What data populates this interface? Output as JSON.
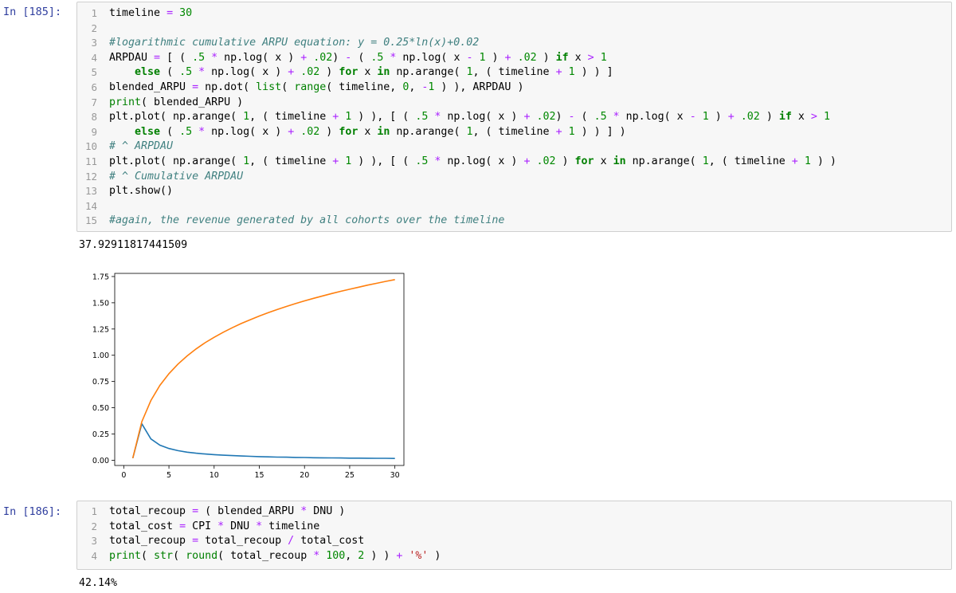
{
  "cells": [
    {
      "prompt": "In [185]:",
      "lines": [
        [
          [
            "timeline ",
            ""
          ],
          [
            "=",
            "o"
          ],
          [
            " ",
            ""
          ],
          [
            "30",
            "n"
          ]
        ],
        [],
        [
          [
            "#logarithmic cumulative ARPU equation: y = 0.25*ln(x)+0.02",
            "c"
          ]
        ],
        [
          [
            "ARPDAU ",
            ""
          ],
          [
            "=",
            "o"
          ],
          [
            " [ ( ",
            ""
          ],
          [
            ".5",
            "n"
          ],
          [
            " ",
            ""
          ],
          [
            "*",
            "o"
          ],
          [
            " np.log( x ) ",
            ""
          ],
          [
            "+",
            "o"
          ],
          [
            " ",
            ""
          ],
          [
            ".02",
            "n"
          ],
          [
            ") ",
            ""
          ],
          [
            "-",
            "o"
          ],
          [
            " ( ",
            ""
          ],
          [
            ".5",
            "n"
          ],
          [
            " ",
            ""
          ],
          [
            "*",
            "o"
          ],
          [
            " np.log( x ",
            ""
          ],
          [
            "-",
            "o"
          ],
          [
            " ",
            ""
          ],
          [
            "1",
            "n"
          ],
          [
            " ) ",
            ""
          ],
          [
            "+",
            "o"
          ],
          [
            " ",
            ""
          ],
          [
            ".02",
            "n"
          ],
          [
            " ) ",
            ""
          ],
          [
            "if",
            "k"
          ],
          [
            " x ",
            ""
          ],
          [
            ">",
            "o"
          ],
          [
            " ",
            ""
          ],
          [
            "1",
            "n"
          ]
        ],
        [
          [
            "    ",
            ""
          ],
          [
            "else",
            "k"
          ],
          [
            " ( ",
            ""
          ],
          [
            ".5",
            "n"
          ],
          [
            " ",
            ""
          ],
          [
            "*",
            "o"
          ],
          [
            " np.log( x ) ",
            ""
          ],
          [
            "+",
            "o"
          ],
          [
            " ",
            ""
          ],
          [
            ".02",
            "n"
          ],
          [
            " ) ",
            ""
          ],
          [
            "for",
            "k"
          ],
          [
            " x ",
            ""
          ],
          [
            "in",
            "k"
          ],
          [
            " np.arange( ",
            ""
          ],
          [
            "1",
            "n"
          ],
          [
            ", ( timeline ",
            ""
          ],
          [
            "+",
            "o"
          ],
          [
            " ",
            ""
          ],
          [
            "1",
            "n"
          ],
          [
            " ) ) ]",
            ""
          ]
        ],
        [
          [
            "blended_ARPU ",
            ""
          ],
          [
            "=",
            "o"
          ],
          [
            " np.dot( ",
            ""
          ],
          [
            "list",
            "b"
          ],
          [
            "( ",
            ""
          ],
          [
            "range",
            "b"
          ],
          [
            "( timeline, ",
            ""
          ],
          [
            "0",
            "n"
          ],
          [
            ", ",
            ""
          ],
          [
            "-",
            "o"
          ],
          [
            "1",
            "n"
          ],
          [
            " ) ), ARPDAU )",
            ""
          ]
        ],
        [
          [
            "print",
            "b"
          ],
          [
            "( blended_ARPU )",
            ""
          ]
        ],
        [
          [
            "plt.plot( np.arange( ",
            ""
          ],
          [
            "1",
            "n"
          ],
          [
            ", ( timeline ",
            ""
          ],
          [
            "+",
            "o"
          ],
          [
            " ",
            ""
          ],
          [
            "1",
            "n"
          ],
          [
            " ) ), [ ( ",
            ""
          ],
          [
            ".5",
            "n"
          ],
          [
            " ",
            ""
          ],
          [
            "*",
            "o"
          ],
          [
            " np.log( x ) ",
            ""
          ],
          [
            "+",
            "o"
          ],
          [
            " ",
            ""
          ],
          [
            ".02",
            "n"
          ],
          [
            ") ",
            ""
          ],
          [
            "-",
            "o"
          ],
          [
            " ( ",
            ""
          ],
          [
            ".5",
            "n"
          ],
          [
            " ",
            ""
          ],
          [
            "*",
            "o"
          ],
          [
            " np.log( x ",
            ""
          ],
          [
            "-",
            "o"
          ],
          [
            " ",
            ""
          ],
          [
            "1",
            "n"
          ],
          [
            " ) ",
            ""
          ],
          [
            "+",
            "o"
          ],
          [
            " ",
            ""
          ],
          [
            ".02",
            "n"
          ],
          [
            " ) ",
            ""
          ],
          [
            "if",
            "k"
          ],
          [
            " x ",
            ""
          ],
          [
            ">",
            "o"
          ],
          [
            " ",
            ""
          ],
          [
            "1",
            "n"
          ]
        ],
        [
          [
            "    ",
            ""
          ],
          [
            "else",
            "k"
          ],
          [
            " ( ",
            ""
          ],
          [
            ".5",
            "n"
          ],
          [
            " ",
            ""
          ],
          [
            "*",
            "o"
          ],
          [
            " np.log( x ) ",
            ""
          ],
          [
            "+",
            "o"
          ],
          [
            " ",
            ""
          ],
          [
            ".02",
            "n"
          ],
          [
            " ) ",
            ""
          ],
          [
            "for",
            "k"
          ],
          [
            " x ",
            ""
          ],
          [
            "in",
            "k"
          ],
          [
            " np.arange( ",
            ""
          ],
          [
            "1",
            "n"
          ],
          [
            ", ( timeline ",
            ""
          ],
          [
            "+",
            "o"
          ],
          [
            " ",
            ""
          ],
          [
            "1",
            "n"
          ],
          [
            " ) ) ] )",
            ""
          ]
        ],
        [
          [
            "# ^ ARPDAU",
            "c"
          ]
        ],
        [
          [
            "plt.plot( np.arange( ",
            ""
          ],
          [
            "1",
            "n"
          ],
          [
            ", ( timeline ",
            ""
          ],
          [
            "+",
            "o"
          ],
          [
            " ",
            ""
          ],
          [
            "1",
            "n"
          ],
          [
            " ) ), [ ( ",
            ""
          ],
          [
            ".5",
            "n"
          ],
          [
            " ",
            ""
          ],
          [
            "*",
            "o"
          ],
          [
            " np.log( x ) ",
            ""
          ],
          [
            "+",
            "o"
          ],
          [
            " ",
            ""
          ],
          [
            ".02",
            "n"
          ],
          [
            " ) ",
            ""
          ],
          [
            "for",
            "k"
          ],
          [
            " x ",
            ""
          ],
          [
            "in",
            "k"
          ],
          [
            " np.arange( ",
            ""
          ],
          [
            "1",
            "n"
          ],
          [
            ", ( timeline ",
            ""
          ],
          [
            "+",
            "o"
          ],
          [
            " ",
            ""
          ],
          [
            "1",
            "n"
          ],
          [
            " ) )",
            ""
          ]
        ],
        [
          [
            "# ^ Cumulative ARPDAU",
            "c"
          ]
        ],
        [
          [
            "plt.show()",
            ""
          ]
        ],
        [],
        [
          [
            "#again, the revenue generated by all cohorts over the timeline",
            "c"
          ]
        ]
      ],
      "output": "37.92911817441509"
    },
    {
      "prompt": "In [186]:",
      "lines": [
        [
          [
            "total_recoup ",
            ""
          ],
          [
            "=",
            "o"
          ],
          [
            " ( blended_ARPU ",
            ""
          ],
          [
            "*",
            "o"
          ],
          [
            " DNU )",
            ""
          ]
        ],
        [
          [
            "total_cost ",
            ""
          ],
          [
            "=",
            "o"
          ],
          [
            " CPI ",
            ""
          ],
          [
            "*",
            "o"
          ],
          [
            " DNU ",
            ""
          ],
          [
            "*",
            "o"
          ],
          [
            " timeline",
            ""
          ]
        ],
        [
          [
            "total_recoup ",
            ""
          ],
          [
            "=",
            "o"
          ],
          [
            " total_recoup ",
            ""
          ],
          [
            "/",
            "o"
          ],
          [
            " total_cost",
            ""
          ]
        ],
        [
          [
            "print",
            "b"
          ],
          [
            "( ",
            ""
          ],
          [
            "str",
            "b"
          ],
          [
            "( ",
            ""
          ],
          [
            "round",
            "b"
          ],
          [
            "( total_recoup ",
            ""
          ],
          [
            "*",
            "o"
          ],
          [
            " ",
            ""
          ],
          [
            "100",
            "n"
          ],
          [
            ", ",
            ""
          ],
          [
            "2",
            "n"
          ],
          [
            " ) ) ",
            ""
          ],
          [
            "+",
            "o"
          ],
          [
            " ",
            ""
          ],
          [
            "'%'",
            "s"
          ],
          [
            " )",
            ""
          ]
        ]
      ],
      "output": "42.14%"
    }
  ],
  "chart_data": {
    "type": "line",
    "title": "",
    "xlabel": "",
    "ylabel": "",
    "xlim": [
      -1,
      31
    ],
    "ylim": [
      -0.05,
      1.78
    ],
    "xticks": [
      "0",
      "5",
      "10",
      "15",
      "20",
      "25",
      "30"
    ],
    "yticks": [
      "0.00",
      "0.25",
      "0.50",
      "0.75",
      "1.00",
      "1.25",
      "1.50",
      "1.75"
    ],
    "grid": false,
    "legend": "none",
    "series": [
      {
        "color": "#1f77b4",
        "x": [
          1,
          2,
          3,
          4,
          5,
          6,
          7,
          8,
          9,
          10,
          11,
          12,
          13,
          14,
          15,
          16,
          17,
          18,
          19,
          20,
          21,
          22,
          23,
          24,
          25,
          26,
          27,
          28,
          29,
          30
        ],
        "y": [
          0.02,
          0.347,
          0.203,
          0.144,
          0.112,
          0.091,
          0.077,
          0.067,
          0.059,
          0.053,
          0.048,
          0.044,
          0.04,
          0.037,
          0.034,
          0.032,
          0.03,
          0.029,
          0.027,
          0.026,
          0.024,
          0.023,
          0.022,
          0.021,
          0.02,
          0.02,
          0.019,
          0.018,
          0.018,
          0.017
        ]
      },
      {
        "color": "#ff7f0e",
        "x": [
          1,
          2,
          3,
          4,
          5,
          6,
          7,
          8,
          9,
          10,
          11,
          12,
          13,
          14,
          15,
          16,
          17,
          18,
          19,
          20,
          21,
          22,
          23,
          24,
          25,
          26,
          27,
          28,
          29,
          30
        ],
        "y": [
          0.02,
          0.367,
          0.569,
          0.713,
          0.825,
          0.916,
          0.993,
          1.06,
          1.119,
          1.171,
          1.219,
          1.262,
          1.302,
          1.339,
          1.374,
          1.406,
          1.437,
          1.465,
          1.492,
          1.518,
          1.542,
          1.565,
          1.588,
          1.609,
          1.629,
          1.649,
          1.668,
          1.686,
          1.704,
          1.721
        ]
      }
    ]
  }
}
